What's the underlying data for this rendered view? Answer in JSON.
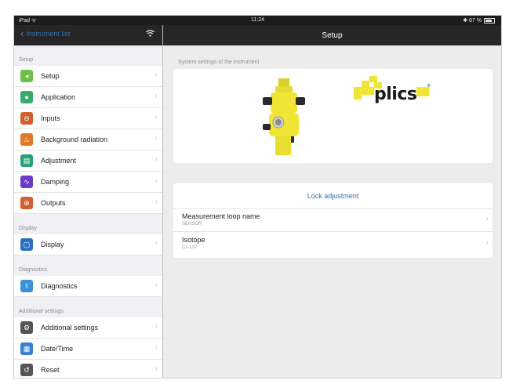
{
  "status": {
    "left": "iPad ᯤ",
    "time": "11:24",
    "right": "✱ 87 %"
  },
  "nav": {
    "back_label": "Instrument list",
    "title": "Setup"
  },
  "sidebar": {
    "sections": [
      {
        "header": "Setup",
        "items": [
          {
            "label": "Setup",
            "icon": "setup-icon",
            "color": "#6cc04a"
          },
          {
            "label": "Application",
            "icon": "application-icon",
            "color": "#3aab6e"
          },
          {
            "label": "Inputs",
            "icon": "inputs-icon",
            "color": "#d2602e"
          },
          {
            "label": "Background radiation",
            "icon": "background-radiation-icon",
            "color": "#e07a2a"
          },
          {
            "label": "Adjustment",
            "icon": "adjustment-icon",
            "color": "#2aa07a"
          },
          {
            "label": "Damping",
            "icon": "damping-icon",
            "color": "#6b3cc8"
          },
          {
            "label": "Outputs",
            "icon": "outputs-icon",
            "color": "#d2602e"
          }
        ]
      },
      {
        "header": "Display",
        "items": [
          {
            "label": "Display",
            "icon": "display-icon",
            "color": "#2a6fc0"
          }
        ]
      },
      {
        "header": "Diagnostics",
        "items": [
          {
            "label": "Diagnostics",
            "icon": "diagnostics-icon",
            "color": "#3a92d8"
          }
        ]
      },
      {
        "header": "Additional settings",
        "items": [
          {
            "label": "Additional settings",
            "icon": "additional-settings-icon",
            "color": "#555555"
          },
          {
            "label": "Date/Time",
            "icon": "date-time-icon",
            "color": "#3a7fd0"
          },
          {
            "label": "Reset",
            "icon": "reset-icon",
            "color": "#555555"
          }
        ]
      }
    ]
  },
  "main": {
    "caption": "System settings of the instrument",
    "logo_text": "plics",
    "logo_reg": "®",
    "lock_label": "Lock adjustment",
    "rows": [
      {
        "title": "Measurement loop name",
        "value": "SENSOR"
      },
      {
        "title": "Isotope",
        "value": "Cs-137"
      }
    ]
  }
}
